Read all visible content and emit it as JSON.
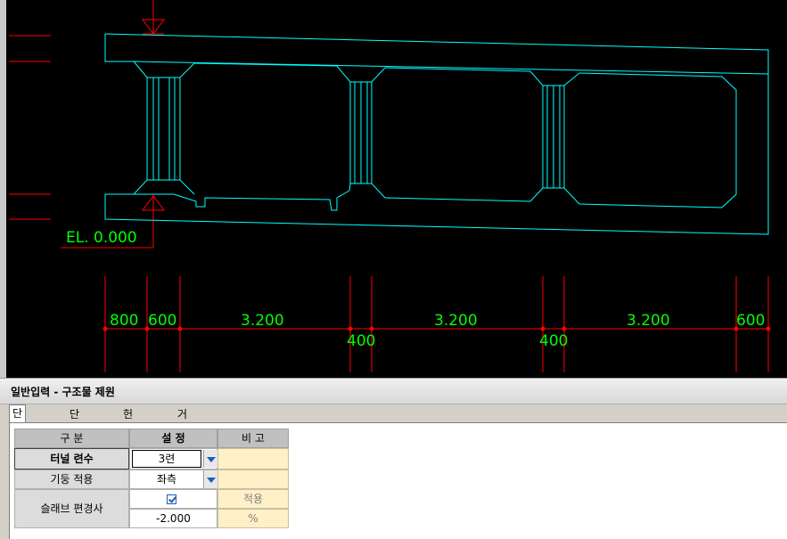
{
  "drawing": {
    "elevation_label": "EL. 0.000",
    "dimensions_top": [
      "800",
      "600",
      "3.200",
      "3.200",
      "3.200",
      "600"
    ],
    "dimensions_bottom": [
      "400",
      "400"
    ]
  },
  "panel": {
    "title": "일반입력 - 구조물 제원",
    "tabs": [
      "단면구성",
      "단면제원",
      "헌치제원",
      "거더제원"
    ],
    "table": {
      "headers": {
        "col1": "구 분",
        "col2": "설 정",
        "col3": "비 고"
      },
      "rows": {
        "tunnel_count": {
          "label": "터널 련수",
          "value": "3련"
        },
        "column_apply": {
          "label": "기둥 적용",
          "value": "좌측"
        },
        "slab_slope": {
          "label": "슬래브 편경사",
          "apply_label": "적용",
          "checked": true,
          "value": "-2.000",
          "unit": "%"
        }
      }
    }
  },
  "colors": {
    "cad_background": "#000000",
    "outline": "#00ffff",
    "dimension": "#ff0000",
    "text": "#00ff00",
    "remark_bg": "#fff0c8"
  }
}
